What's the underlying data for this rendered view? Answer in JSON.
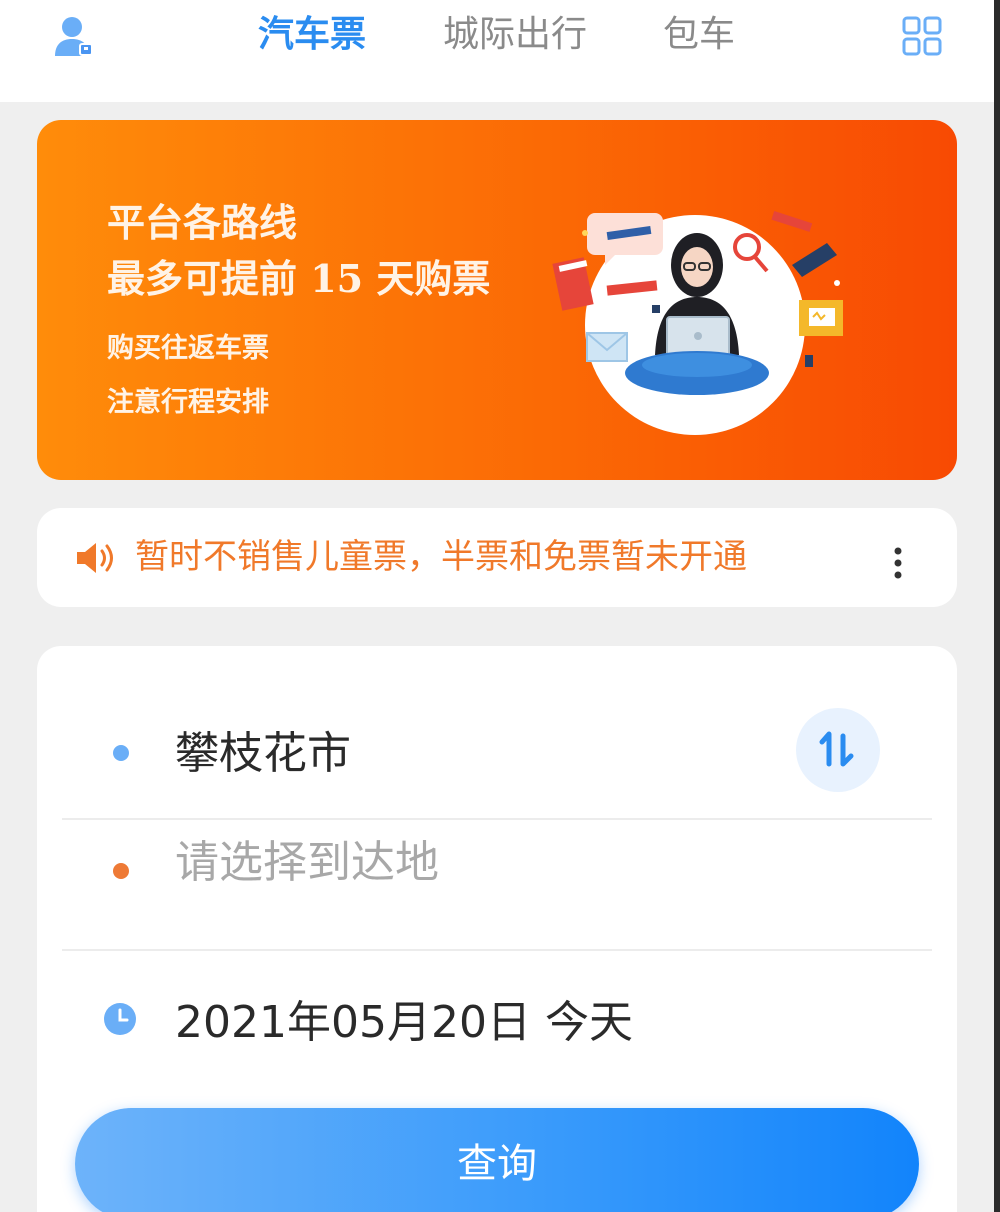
{
  "header": {
    "tabs": [
      {
        "label": "汽车票",
        "active": true
      },
      {
        "label": "城际出行",
        "active": false
      },
      {
        "label": "包车",
        "active": false
      }
    ],
    "user_icon": "user-icon",
    "menu_icon": "grid-menu-icon"
  },
  "banner": {
    "line1": "平台各路线",
    "line2": "最多可提前 15 天购票",
    "line3": "购买往返车票",
    "line4": "注意行程安排"
  },
  "notice": {
    "text": "暂时不销售儿童票，半票和免票暂未开通",
    "icon": "speaker-icon"
  },
  "form": {
    "departure": "攀枝花市",
    "destination_placeholder": "请选择到达地",
    "date": "2021年05月20日 今天",
    "swap_label": "1↓",
    "query_label": "查询"
  },
  "colors": {
    "accent_blue": "#2a8cf0",
    "notice_orange": "#f0792a",
    "banner_start": "#ff8c0a",
    "banner_end": "#f84a03"
  }
}
